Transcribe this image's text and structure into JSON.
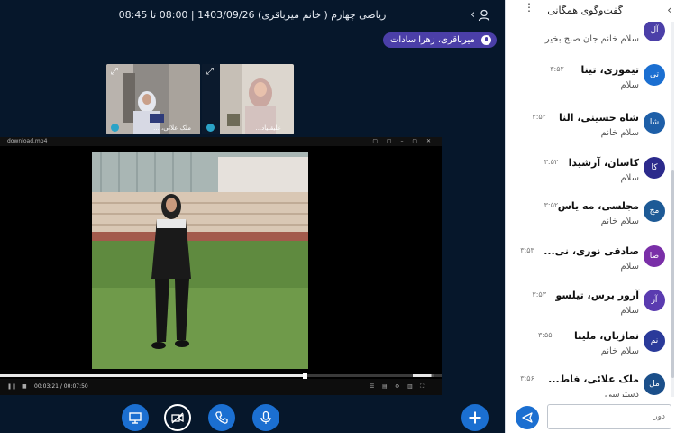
{
  "meeting": {
    "title": "ریاضی چهارم ( خانم میرباقری) 1403/09/26 | 08:00 تا 08:45",
    "presenter_name": "میرباقری، زهرا سادات"
  },
  "webcams": [
    {
      "name": "ملک علائی، ..."
    },
    {
      "name": "علیقلیاد..."
    }
  ],
  "player": {
    "file_label": "download.mp4",
    "time": "00:03:21 / 00:07:50",
    "progress": 0.69,
    "volume": 0.85
  },
  "controls": {
    "screen_share": "desktop-icon",
    "camera": "video-off-icon",
    "phone": "phone-icon",
    "mic": "microphone-icon",
    "add": "plus-icon"
  },
  "chat": {
    "title": "گفت‌وگوی همگانی",
    "input_placeholder": "دور",
    "messages": [
      {
        "initials": "آل",
        "sender": "",
        "time": "",
        "text": "سلام خانم جان صبح بخیر",
        "color": "#4b3fa8"
      },
      {
        "initials": "تی",
        "sender": "تیموری، تینا",
        "time": "۳:۵۲",
        "text": "سلام",
        "color": "#1b6fd1"
      },
      {
        "initials": "شا",
        "sender": "شاه حسینی، النا",
        "time": "۳:۵۲",
        "text": "سلام خانم",
        "color": "#1e5fa8"
      },
      {
        "initials": "کا",
        "sender": "کاسان، آرشیدا",
        "time": "۳:۵۲",
        "text": "سلام",
        "color": "#2c2a8c"
      },
      {
        "initials": "مج",
        "sender": "مجلسی، مه یاس",
        "time": "۳:۵۲",
        "text": "سلام خانم",
        "color": "#1d5a96"
      },
      {
        "initials": "صا",
        "sender": "صادقی نوری، نی...",
        "time": "۳:۵۳",
        "text": "سلام",
        "color": "#7a2fa8"
      },
      {
        "initials": "آر",
        "sender": "آرور برس، تیلسو",
        "time": "۳:۵۳",
        "text": "سلام",
        "color": "#5a3bb0"
      },
      {
        "initials": "نم",
        "sender": "نمازیان، ملینا",
        "time": "۳:۵۵",
        "text": "سلام خانم",
        "color": "#2a3a9a"
      },
      {
        "initials": "مل",
        "sender": "ملک علائی، فاط...",
        "time": "۳:۵۶",
        "text": "دسترسی",
        "color": "#1b4f8a"
      }
    ]
  }
}
